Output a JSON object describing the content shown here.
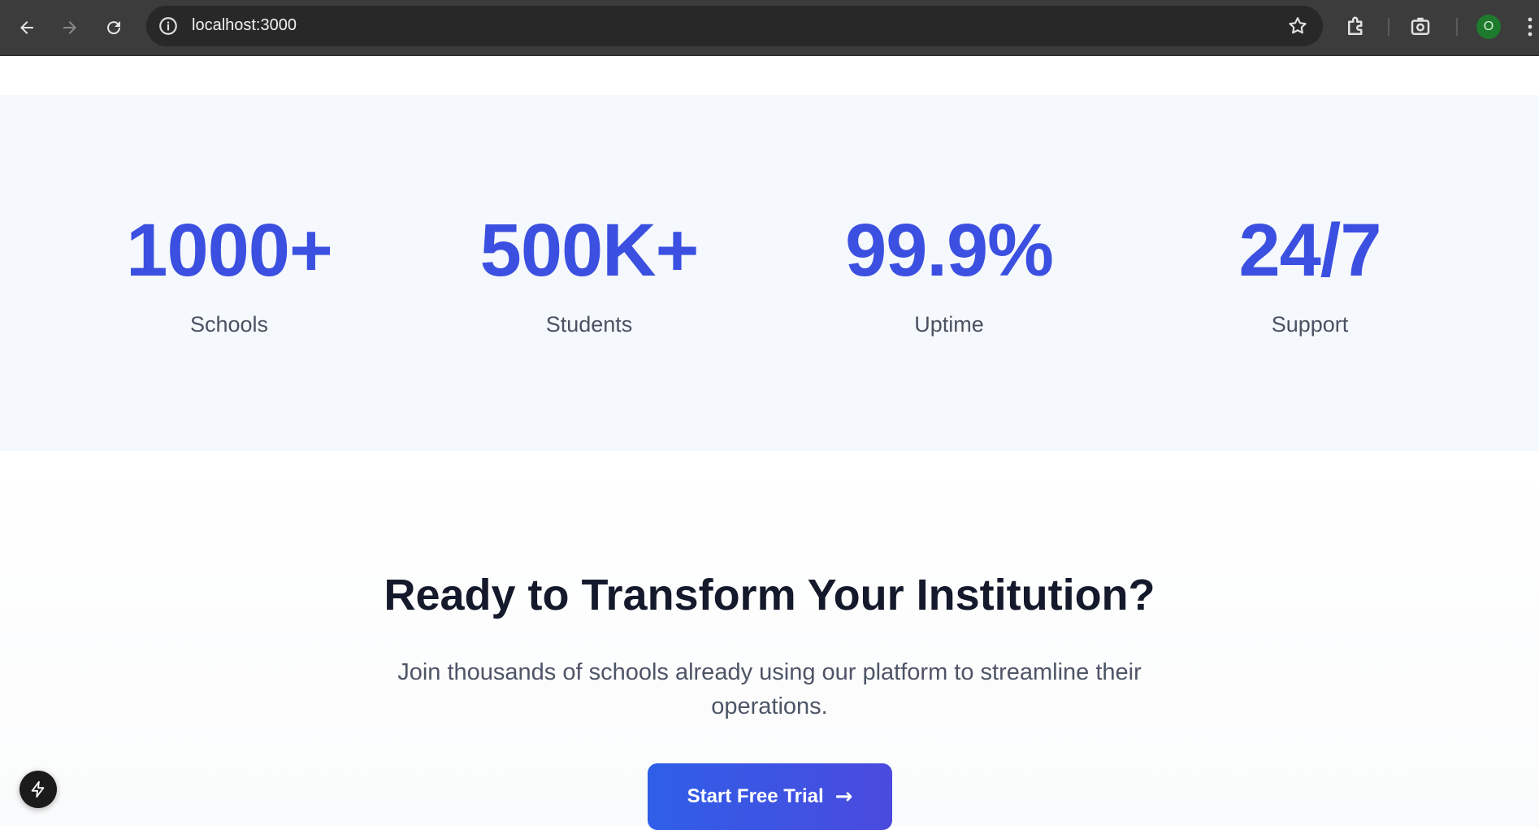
{
  "browser": {
    "url": "localhost:3000",
    "profile_initial": "O",
    "icons": [
      "back-arrow-icon",
      "forward-arrow-icon",
      "reload-icon",
      "site-info-icon",
      "bookmark-star-icon",
      "extensions-icon",
      "screenshot-icon",
      "menu-kebab-icon"
    ]
  },
  "stats": [
    {
      "value": "1000+",
      "label": "Schools"
    },
    {
      "value": "500K+",
      "label": "Students"
    },
    {
      "value": "99.9%",
      "label": "Uptime"
    },
    {
      "value": "24/7",
      "label": "Support"
    }
  ],
  "cta": {
    "title": "Ready to Transform Your Institution?",
    "subtitle": "Join thousands of schools already using our platform to streamline their operations.",
    "button_label": "Start Free Trial",
    "button_arrow": "→"
  },
  "colors": {
    "stat_accent": "#3b50e0",
    "stats_bg": "#f5f8fc",
    "button_start": "#2f5fe8",
    "button_end": "#4a4ade"
  },
  "dev_badge": {
    "icon": "lightning-icon"
  }
}
